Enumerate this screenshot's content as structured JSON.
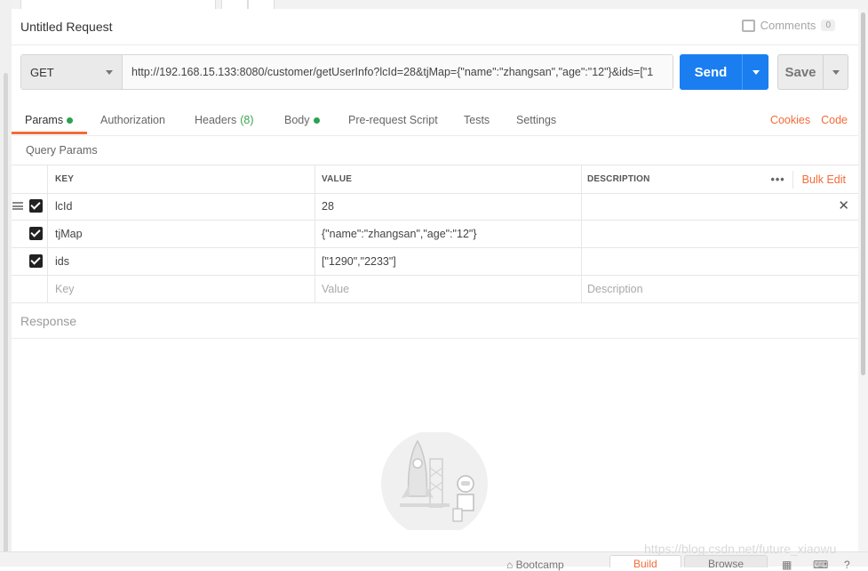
{
  "request": {
    "title": "Untitled Request"
  },
  "comments": {
    "label": "Comments",
    "count": "0"
  },
  "url_bar": {
    "method": "GET",
    "url": "http://192.168.15.133:8080/customer/getUserInfo?lcId=28&tjMap={\"name\":\"zhangsan\",\"age\":\"12\"}&ids=[\"1"
  },
  "actions": {
    "send_label": "Send",
    "save_label": "Save"
  },
  "tabs": [
    {
      "label": "Params",
      "dot": true,
      "active": true
    },
    {
      "label": "Authorization"
    },
    {
      "label": "Headers",
      "count": "(8)"
    },
    {
      "label": "Body",
      "dot": true
    },
    {
      "label": "Pre-request Script"
    },
    {
      "label": "Tests"
    },
    {
      "label": "Settings"
    }
  ],
  "right_links": {
    "cookies": "Cookies",
    "code": "Code"
  },
  "query_params": {
    "label": "Query Params",
    "headers": {
      "key": "KEY",
      "value": "VALUE",
      "description": "DESCRIPTION"
    },
    "more": "•••",
    "bulk_edit": "Bulk Edit",
    "rows": [
      {
        "key": "lcId",
        "value": "28",
        "description": ""
      },
      {
        "key": "tjMap",
        "value": "{\"name\":\"zhangsan\",\"age\":\"12\"}",
        "description": ""
      },
      {
        "key": "ids",
        "value": "[\"1290\",\"2233\"]",
        "description": ""
      }
    ],
    "placeholders": {
      "key": "Key",
      "value": "Value",
      "description": "Description"
    }
  },
  "response": {
    "label": "Response"
  },
  "statusbar": {
    "bootcamp": "Bootcamp",
    "build": "Build",
    "browse": "Browse"
  },
  "watermark": "https://blog.csdn.net/future_xiaowu",
  "colors": {
    "send": "#1a7ef0",
    "accent": "#f26b3a",
    "dot": "#2aa350"
  }
}
